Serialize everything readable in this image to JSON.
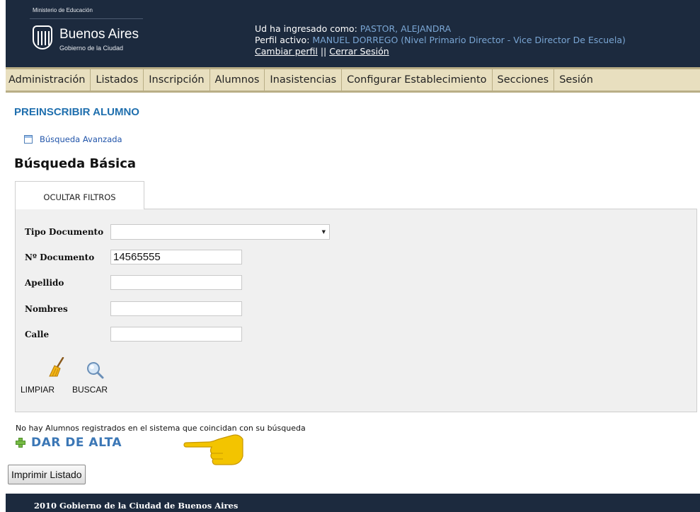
{
  "header": {
    "ministry": "Ministerio de Educación",
    "brand": "Buenos Aires",
    "brand_sub": "Gobierno de la Ciudad",
    "logged_in_label": "Ud ha ingresado como: ",
    "logged_in_user": "PASTOR, ALEJANDRA",
    "profile_label": "Perfil activo: ",
    "profile_value": "MANUEL DORREGO (Nivel Primario Director - Vice Director De Escuela)",
    "change_profile": "Cambiar perfil",
    "separator": " || ",
    "logout": "Cerrar Sesión"
  },
  "menu": {
    "items": [
      "Administración",
      "Listados",
      "Inscripción",
      "Alumnos",
      "Inasistencias",
      "Configurar Establecimiento",
      "Secciones",
      "Sesión"
    ]
  },
  "page": {
    "title": "PREINSCRIBIR ALUMNO",
    "advanced_search": "Búsqueda Avanzada",
    "section_title": "Búsqueda Básica",
    "tab_label": "OCULTAR FILTROS"
  },
  "filters": {
    "tipo_documento": {
      "label": "Tipo Documento",
      "value": ""
    },
    "nro_documento": {
      "label": "Nº Documento",
      "value": "14565555"
    },
    "apellido": {
      "label": "Apellido",
      "value": ""
    },
    "nombres": {
      "label": "Nombres",
      "value": ""
    },
    "calle": {
      "label": "Calle",
      "value": ""
    },
    "clear_label": "LIMPIAR",
    "search_label": "BUSCAR"
  },
  "results": {
    "message": "No hay Alumnos registrados en el sistema que coincidan con su búsqueda",
    "add_label": "DAR DE ALTA",
    "print_label": "Imprimir Listado"
  },
  "footer": {
    "text": "2010 Gobierno de la Ciudad de Buenos Aires"
  },
  "colors": {
    "header_bg": "#1c2a3e",
    "menu_bg": "#e8dfbf",
    "title_blue": "#1f6fae",
    "add_green": "#77bb44",
    "pointer_yellow": "#f3c400"
  }
}
